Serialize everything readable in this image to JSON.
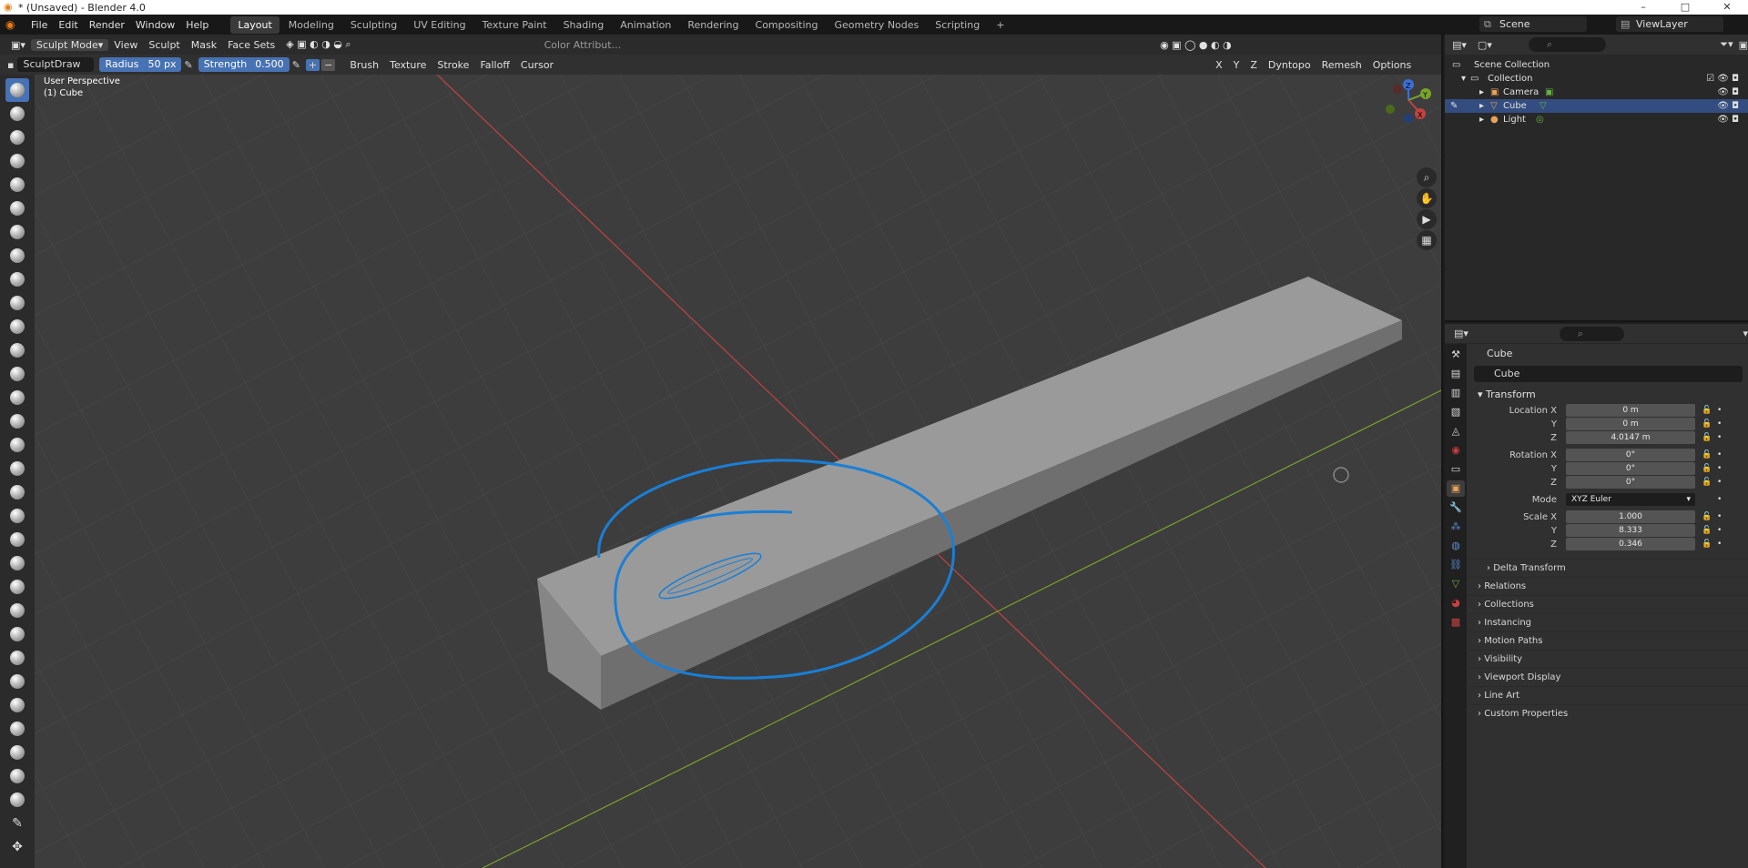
{
  "window": {
    "title": "* (Unsaved) - Blender 4.0",
    "controls": [
      "–",
      "□",
      "✕"
    ]
  },
  "menu": {
    "items": [
      "File",
      "Edit",
      "Render",
      "Window",
      "Help"
    ]
  },
  "workspaces": [
    "Layout",
    "Modeling",
    "Sculpting",
    "UV Editing",
    "Texture Paint",
    "Shading",
    "Animation",
    "Rendering",
    "Compositing",
    "Geometry Nodes",
    "Scripting"
  ],
  "active_workspace": "Layout",
  "scene": "Scene",
  "view_layer": "ViewLayer",
  "viewport_header": {
    "mode": "Sculpt Mode",
    "menus": [
      "View",
      "Sculpt",
      "Mask",
      "Face Sets"
    ],
    "color_attribute": "Color Attribut...",
    "right": [
      "Dyntopo",
      "Remesh",
      "Options"
    ],
    "axes": [
      "X",
      "Y",
      "Z"
    ]
  },
  "tool_settings": {
    "brush_name": "SculptDraw",
    "radius_label": "Radius",
    "radius_value": "50 px",
    "strength_label": "Strength",
    "strength_value": "0.500",
    "menus": [
      "Brush",
      "Texture",
      "Stroke",
      "Falloff",
      "Cursor"
    ]
  },
  "viewport_overlay": {
    "line1": "User Perspective",
    "line2": "(1) Cube"
  },
  "gizmo_labels": {
    "x": "X",
    "y": "Y",
    "z": "Z"
  },
  "outliner": {
    "root": "Scene Collection",
    "collection": "Collection",
    "items": [
      "Camera",
      "Cube",
      "Light"
    ],
    "selected": "Cube"
  },
  "properties": {
    "object_label": "Cube",
    "object_name": "Cube",
    "transform": {
      "title": "Transform",
      "location": {
        "label": "Location X",
        "x": "0 m",
        "y": "0 m",
        "z": "4.0147 m"
      },
      "rotation": {
        "label": "Rotation X",
        "x": "0°",
        "y": "0°",
        "z": "0°"
      },
      "mode_label": "Mode",
      "mode": "XYZ Euler",
      "scale": {
        "label": "Scale X",
        "x": "1.000",
        "y": "8.333",
        "z": "0.346"
      },
      "axis_y": "Y",
      "axis_z": "Z"
    },
    "subpanels": [
      "Delta Transform",
      "Relations",
      "Collections",
      "Instancing",
      "Motion Paths",
      "Visibility",
      "Viewport Display",
      "Line Art",
      "Custom Properties"
    ]
  },
  "colors": {
    "accent": "#4772b3",
    "annotation": "#1a7fd6",
    "x_axis": "#c24242",
    "y_axis": "#79a32c"
  }
}
